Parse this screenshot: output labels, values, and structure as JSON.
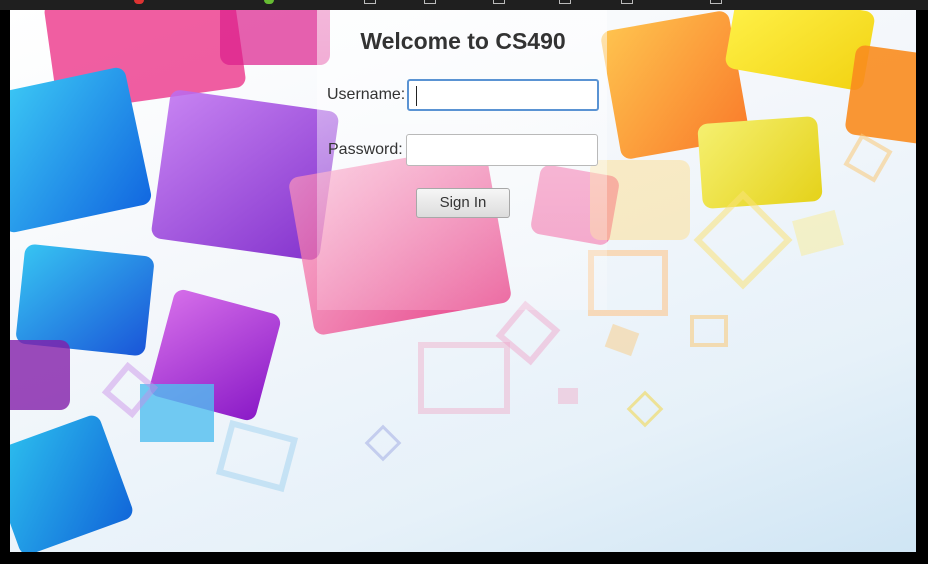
{
  "page": {
    "title": "Welcome to CS490"
  },
  "form": {
    "username_label": "Username:",
    "username_value": "",
    "password_label": "Password:",
    "password_value": "",
    "signin_label": "Sign In"
  },
  "colors": {
    "title_text": "#333333",
    "focus_border": "#5a93d3",
    "button_border": "#a8a8a8"
  }
}
